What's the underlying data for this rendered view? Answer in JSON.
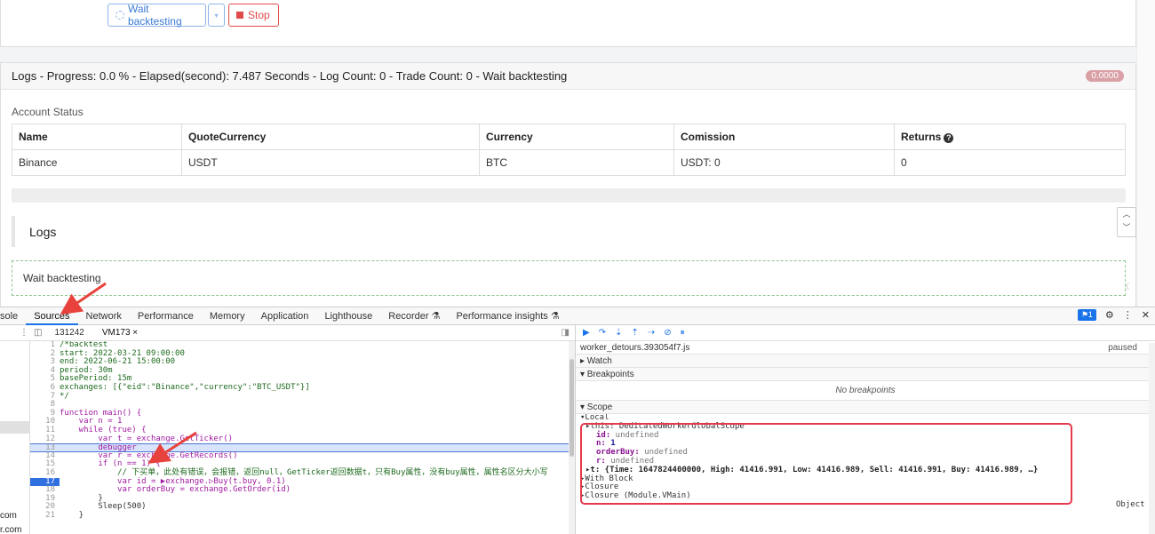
{
  "toolbar": {
    "wait_label": "Wait backtesting",
    "caret": "▾",
    "stop_label": "Stop"
  },
  "logs_panel": {
    "header": "Logs - Progress: 0.0 % - Elapsed(second): 7.487 Seconds - Log Count: 0 - Trade Count: 0 - Wait backtesting",
    "badge": "0.0000",
    "account_status_label": "Account Status",
    "table": {
      "headers": [
        "Name",
        "QuoteCurrency",
        "Currency",
        "Comission",
        "Returns"
      ],
      "rows": [
        [
          "Binance",
          "USDT",
          "BTC",
          "USDT: 0",
          "0"
        ]
      ]
    },
    "logs_title": "Logs",
    "wait_message": "Wait backtesting"
  },
  "devtools": {
    "tabs": [
      "sole",
      "Sources",
      "Network",
      "Performance",
      "Memory",
      "Application",
      "Lighthouse",
      "Recorder ⚗",
      "Performance insights ⚗"
    ],
    "active_tab": "Sources",
    "message_count": "1",
    "file_tabs": [
      "131242",
      "VM173 ×"
    ],
    "navigator_domains": [
      "com",
      "r.com"
    ],
    "code_lines": [
      {
        "no": "1",
        "text": "/*backtest"
      },
      {
        "no": "2",
        "text": "start: 2022-03-21 09:00:00"
      },
      {
        "no": "3",
        "text": "end: 2022-06-21 15:00:00"
      },
      {
        "no": "4",
        "text": "period: 30m"
      },
      {
        "no": "5",
        "text": "basePeriod: 15m"
      },
      {
        "no": "6",
        "text": "exchanges: [{\"eid\":\"Binance\",\"currency\":\"BTC_USDT\"}]"
      },
      {
        "no": "7",
        "text": "*/"
      },
      {
        "no": "8",
        "text": ""
      },
      {
        "no": "9",
        "text": "function main() {"
      },
      {
        "no": "10",
        "text": "    var n = 1"
      },
      {
        "no": "11",
        "text": "    while (true) {"
      },
      {
        "no": "12",
        "text": "        var t = exchange.GetTicker()"
      },
      {
        "no": "13",
        "text": "        debugger"
      },
      {
        "no": "14",
        "text": "        var r = exchange.GetRecords()"
      },
      {
        "no": "15",
        "text": "        if (n == 1) {"
      },
      {
        "no": "16",
        "text": "            // 下买单，此处有错误，会报错，返回null，GetTicker返回数据t，只有Buy属性，没有buy属性，属性名区分大小写"
      },
      {
        "no": "17",
        "text": "            var id = ▶exchange.▷Buy(t.buy, 0.1)"
      },
      {
        "no": "18",
        "text": "            var orderBuy = exchange.GetOrder(id)"
      },
      {
        "no": "19",
        "text": "        }"
      },
      {
        "no": "20",
        "text": "        Sleep(500)"
      },
      {
        "no": "21",
        "text": "    }"
      }
    ],
    "debugger": {
      "thread": "worker_detours.393054f7.js",
      "thread_status": "paused",
      "watch": "▸ Watch",
      "breakpoints": "▾ Breakpoints",
      "no_breakpoints": "No breakpoints",
      "scope": "▾ Scope",
      "local": "▾Local",
      "this_line": "▸this: DedicatedWorkerGlobalScope",
      "vars": [
        {
          "key": "id:",
          "val": " undefined"
        },
        {
          "key": "n:",
          "val": " 1"
        },
        {
          "key": "orderBuy:",
          "val": " undefined"
        },
        {
          "key": "r:",
          "val": " undefined"
        }
      ],
      "t_line": "▸t: {Time: 1647824400000, High: 41416.991, Low: 41416.989, Sell: 41416.991, Buy: 41416.989, …}",
      "with_block": "▸With Block",
      "object_label": "Object",
      "closure": "▸Closure",
      "closure_module": "▸Closure (Module.VMain)"
    }
  }
}
